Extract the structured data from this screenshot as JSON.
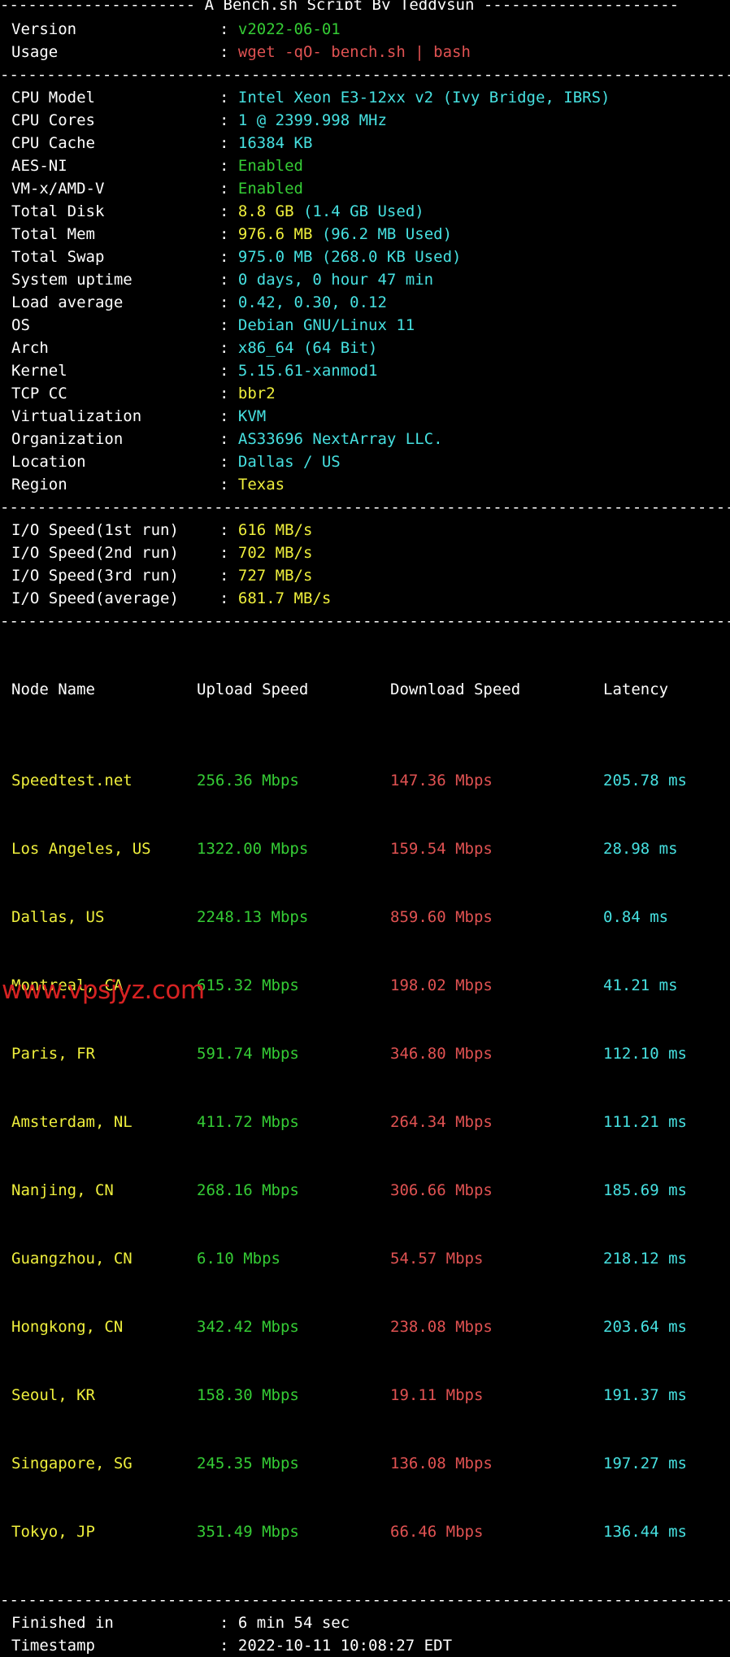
{
  "header": {
    "title_line": "--------------------- A Bench.sh Script By Teddysun ---------------------",
    "rule": "----------------------------------------------------------------------"
  },
  "script_info": {
    "rows": [
      {
        "label": "Version",
        "sep": ":",
        "value": "v2022-06-01",
        "color": "green"
      },
      {
        "label": "Usage",
        "sep": ":",
        "value": "wget -qO- bench.sh | bash",
        "color": "red"
      }
    ]
  },
  "system_info": {
    "rows": [
      {
        "label": "CPU Model",
        "sep": ":",
        "value": "Intel Xeon E3-12xx v2 (Ivy Bridge, IBRS)",
        "color": "cyan"
      },
      {
        "label": "CPU Cores",
        "sep": ":",
        "value": "1 @ 2399.998 MHz",
        "color": "cyan"
      },
      {
        "label": "CPU Cache",
        "sep": ":",
        "value": "16384 KB",
        "color": "cyan"
      },
      {
        "label": "AES-NI",
        "sep": ":",
        "value": "Enabled",
        "color": "green"
      },
      {
        "label": "VM-x/AMD-V",
        "sep": ":",
        "value": "Enabled",
        "color": "green"
      },
      {
        "label": "Total Disk",
        "sep": ":",
        "value": "8.8 GB",
        "color": "yellow",
        "value2": " (1.4 GB Used)",
        "color2": "cyan"
      },
      {
        "label": "Total Mem",
        "sep": ":",
        "value": "976.6 MB",
        "color": "yellow",
        "value2": " (96.2 MB Used)",
        "color2": "cyan"
      },
      {
        "label": "Total Swap",
        "sep": ":",
        "value": "975.0 MB (268.0 KB Used)",
        "color": "cyan"
      },
      {
        "label": "System uptime",
        "sep": ":",
        "value": "0 days, 0 hour 47 min",
        "color": "cyan"
      },
      {
        "label": "Load average",
        "sep": ":",
        "value": "0.42, 0.30, 0.12",
        "color": "cyan"
      },
      {
        "label": "OS",
        "sep": ":",
        "value": "Debian GNU/Linux 11",
        "color": "cyan"
      },
      {
        "label": "Arch",
        "sep": ":",
        "value": "x86_64 (64 Bit)",
        "color": "cyan"
      },
      {
        "label": "Kernel",
        "sep": ":",
        "value": "5.15.61-xanmod1",
        "color": "cyan"
      },
      {
        "label": "TCP CC",
        "sep": ":",
        "value": "bbr2",
        "color": "yellow"
      },
      {
        "label": "Virtualization",
        "sep": ":",
        "value": "KVM",
        "color": "cyan"
      },
      {
        "label": "Organization",
        "sep": ":",
        "value": "AS33696 NextArray LLC.",
        "color": "cyan"
      },
      {
        "label": "Location",
        "sep": ":",
        "value": "Dallas / US",
        "color": "cyan"
      },
      {
        "label": "Region",
        "sep": ":",
        "value": "Texas",
        "color": "yellow"
      }
    ]
  },
  "io_speed": {
    "rows": [
      {
        "label": "I/O Speed(1st run)",
        "sep": ":",
        "value": "616 MB/s",
        "color": "yellow"
      },
      {
        "label": "I/O Speed(2nd run)",
        "sep": ":",
        "value": "702 MB/s",
        "color": "yellow"
      },
      {
        "label": "I/O Speed(3rd run)",
        "sep": ":",
        "value": "727 MB/s",
        "color": "yellow"
      },
      {
        "label": "I/O Speed(average)",
        "sep": ":",
        "value": "681.7 MB/s",
        "color": "yellow"
      }
    ]
  },
  "speedtest": {
    "columns": [
      "Node Name",
      "Upload Speed",
      "Download Speed",
      "Latency"
    ],
    "rows": [
      {
        "node": "Speedtest.net",
        "upload": "256.36 Mbps",
        "download": "147.36 Mbps",
        "latency": "205.78 ms"
      },
      {
        "node": "Los Angeles, US",
        "upload": "1322.00 Mbps",
        "download": "159.54 Mbps",
        "latency": "28.98 ms"
      },
      {
        "node": "Dallas, US",
        "upload": "2248.13 Mbps",
        "download": "859.60 Mbps",
        "latency": "0.84 ms"
      },
      {
        "node": "Montreal, CA",
        "upload": "615.32 Mbps",
        "download": "198.02 Mbps",
        "latency": "41.21 ms"
      },
      {
        "node": "Paris, FR",
        "upload": "591.74 Mbps",
        "download": "346.80 Mbps",
        "latency": "112.10 ms"
      },
      {
        "node": "Amsterdam, NL",
        "upload": "411.72 Mbps",
        "download": "264.34 Mbps",
        "latency": "111.21 ms"
      },
      {
        "node": "Nanjing, CN",
        "upload": "268.16 Mbps",
        "download": "306.66 Mbps",
        "latency": "185.69 ms"
      },
      {
        "node": "Guangzhou, CN",
        "upload": "6.10 Mbps",
        "download": "54.57 Mbps",
        "latency": "218.12 ms"
      },
      {
        "node": "Hongkong, CN",
        "upload": "342.42 Mbps",
        "download": "238.08 Mbps",
        "latency": "203.64 ms"
      },
      {
        "node": "Seoul, KR",
        "upload": "158.30 Mbps",
        "download": "19.11 Mbps",
        "latency": "191.37 ms"
      },
      {
        "node": "Singapore, SG",
        "upload": "245.35 Mbps",
        "download": "136.08 Mbps",
        "latency": "197.27 ms"
      },
      {
        "node": "Tokyo, JP",
        "upload": "351.49 Mbps",
        "download": "66.46 Mbps",
        "latency": "136.44 ms"
      }
    ]
  },
  "footer": {
    "rows": [
      {
        "label": "Finished in",
        "sep": ":",
        "value": "6 min 54 sec",
        "color": "white"
      },
      {
        "label": "Timestamp",
        "sep": ":",
        "value": "2022-10-11 10:08:27 EDT",
        "color": "white"
      }
    ]
  },
  "watermark": {
    "text": "www.vpsjyz.com",
    "color": "#d62222"
  },
  "colors": {
    "background": "#000000",
    "foreground": "#ffffff",
    "cyan": "#46e0e0",
    "green": "#35cc35",
    "yellow": "#eeee3c",
    "red": "#e05252"
  }
}
